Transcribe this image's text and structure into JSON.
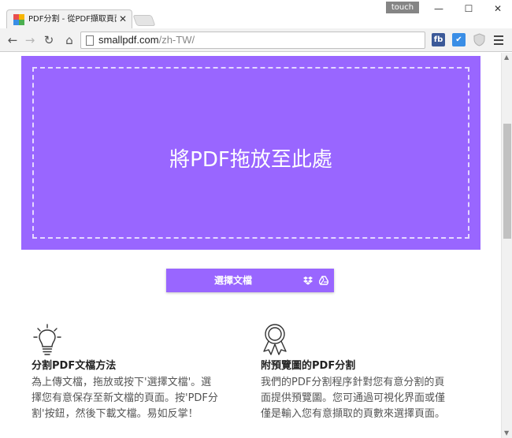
{
  "browser": {
    "tab_title": "PDF分割 - 從PDF擷取頁面",
    "tab_close": "✕",
    "touch_badge": "touch",
    "window_controls": {
      "minimize": "—",
      "maximize": "☐",
      "close": "✕"
    },
    "nav": {
      "back": "←",
      "forward": "→",
      "reload": "↻",
      "home": "⌂"
    },
    "url_host": "smallpdf.com",
    "url_path": "/zh-TW/",
    "extensions": {
      "fb": "fb",
      "check": "✔"
    }
  },
  "page": {
    "dropzone_text": "將PDF拖放至此處",
    "choose_button": "選擇文檔",
    "features": [
      {
        "icon": "lightbulb-icon",
        "title": "分割PDF文檔方法",
        "lines": [
          "為上傳文檔，拖放或按下'選擇文檔'。選",
          "擇您有意保存至新文檔的頁面。按'PDF分",
          "割'按鈕，然後下載文檔。易如反掌！"
        ]
      },
      {
        "icon": "award-ribbon-icon",
        "title": "附預覽圖的PDF分割",
        "lines": [
          "我們的PDF分割程序針對您有意分割的頁",
          "面提供預覽圖。您可通過可視化界面或僅",
          "僅是輸入您有意擷取的頁數來選擇頁面。"
        ]
      }
    ]
  },
  "colors": {
    "brand_purple": "#9966ff",
    "chrome_gray": "#f2f2f2"
  }
}
